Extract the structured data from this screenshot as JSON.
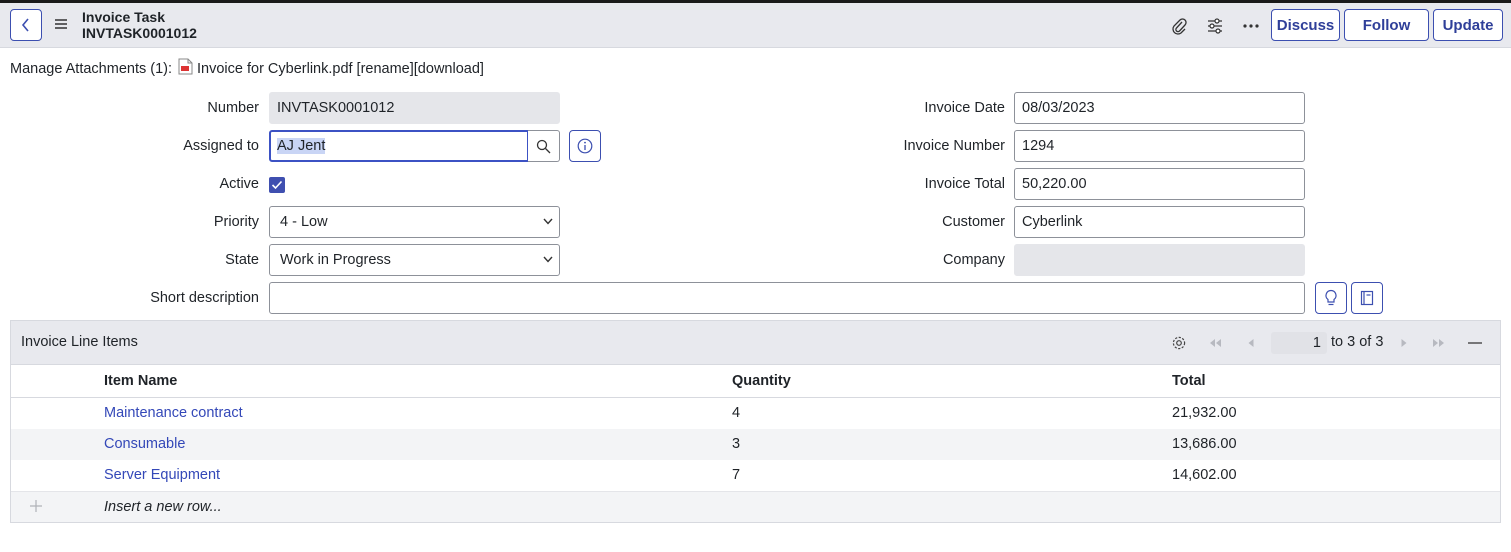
{
  "header": {
    "title": "Invoice Task",
    "record_number": "INVTASK0001012",
    "buttons": {
      "discuss": "Discuss",
      "follow": "Follow",
      "update": "Update"
    },
    "icons": [
      "back-chevron-icon",
      "hamburger-menu-icon",
      "paperclip-icon",
      "sliders-icon",
      "more-icon"
    ]
  },
  "attachments": {
    "label": "Manage Attachments (1):",
    "file_name": "Invoice for Cyberlink.pdf",
    "rename": "[rename]",
    "download": "[download]"
  },
  "form": {
    "number": {
      "label": "Number",
      "value": "INVTASK0001012"
    },
    "assigned_to": {
      "label": "Assigned to",
      "value": "AJ Jent"
    },
    "active": {
      "label": "Active",
      "checked": true
    },
    "priority": {
      "label": "Priority",
      "value": "4 - Low"
    },
    "state": {
      "label": "State",
      "value": "Work in Progress"
    },
    "short_description": {
      "label": "Short description",
      "value": ""
    },
    "invoice_date": {
      "label": "Invoice Date",
      "value": "08/03/2023"
    },
    "invoice_number": {
      "label": "Invoice Number",
      "value": "1294"
    },
    "invoice_total": {
      "label": "Invoice Total",
      "value": "50,220.00"
    },
    "customer": {
      "label": "Customer",
      "value": "Cyberlink"
    },
    "company": {
      "label": "Company",
      "value": ""
    }
  },
  "related_list": {
    "title": "Invoice Line Items",
    "pager": {
      "current": "1",
      "range_text": "to 3 of 3"
    },
    "columns": [
      "Item Name",
      "Quantity",
      "Total"
    ],
    "rows": [
      {
        "item_name": "Maintenance contract",
        "quantity": "4",
        "total": "21,932.00"
      },
      {
        "item_name": "Consumable",
        "quantity": "3",
        "total": "13,686.00"
      },
      {
        "item_name": "Server Equipment",
        "quantity": "7",
        "total": "14,602.00"
      }
    ],
    "insert_row": "Insert a new row..."
  },
  "colors": {
    "accent": "#3c4fb0",
    "link": "#3448b8",
    "header_bg": "#e8e9ee",
    "readonly_bg": "#e5e6ea"
  }
}
